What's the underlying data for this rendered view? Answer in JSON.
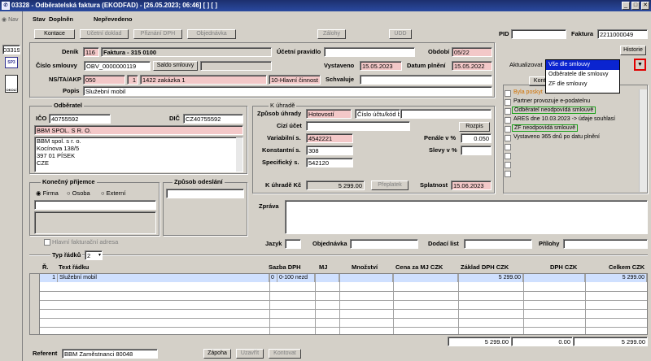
{
  "window": {
    "title": "03328 - Odběratelská faktura (EKODFAD) - [26.05.2023; 06:46] [ ] [ ]",
    "controls": [
      "_",
      "□",
      "✕"
    ]
  },
  "left": {
    "nav": "Nav",
    "code": "03319",
    "icon1": "SP3",
    "icon2": "OKOLÍ"
  },
  "status": {
    "stav_label": "Stav",
    "stav_value": "Doplněn",
    "stav2": "Nepřevedeno"
  },
  "toolbar": {
    "kontace": "Kontace",
    "ucetni_doklad": "Účetní doklad",
    "priznani_dph": "Přiznání DPH",
    "objednavka": "Objednávka",
    "zalohy": "Zálohy",
    "udd": "ÚDD"
  },
  "pid": {
    "label": "PID",
    "value": ""
  },
  "faktura": {
    "label": "Faktura",
    "value": "2211000049"
  },
  "historie": "Historie",
  "header": {
    "denik_label": "Deník",
    "denik_code": "116",
    "denik_name": "Faktura - 315 0100",
    "ucetni_pravidlo_label": "Účetní pravidlo",
    "ucetni_pravidlo": "",
    "obdobi_label": "Období",
    "obdobi": "05/22",
    "cislo_smlouvy_label": "Číslo smlouvy",
    "cislo_smlouvy": "OBV_0000000119",
    "saldo_btn": "Saldo smlouvy",
    "vystaveno_label": "Vystaveno",
    "vystaveno": "15.05.2023",
    "datum_plneni_label": "Datum plnění",
    "datum_plneni": "15.05.2022",
    "ns_label": "NS/TA/AKP",
    "ns": "050",
    "ta": "1",
    "akp": "1422 zakázka 1",
    "cinnost": "10-Hlavní činnost",
    "schvaluje_label": "Schvaluje",
    "schvaluje": "",
    "popis_label": "Popis",
    "popis": "Služební mobil"
  },
  "aktualizovat": "Aktualizovat",
  "kontrola_btn": "Kontrol",
  "dropdown": {
    "selected": "Vše dle smlouvy",
    "options": [
      "Vše dle smlouvy",
      "Odběratele dle smlouvy",
      "ZF dle smlouvy"
    ]
  },
  "checks": [
    {
      "text": "Byla poskyt",
      "color": "#d07000"
    },
    {
      "text": "Partner provozuje e-podatelnu",
      "color": "#000"
    },
    {
      "text": "Odběratel neodpovídá smlouvě",
      "color": "#000"
    },
    {
      "text": "ARES dne 10.03.2023 -> údaje souhlasí",
      "color": "#000"
    },
    {
      "text": "ZF neodpovídá smlouvě",
      "color": "#000"
    },
    {
      "text": "Vystaveno 365 dnů po datu plnění",
      "color": "#000"
    },
    {
      "text": "",
      "color": "#000"
    },
    {
      "text": "",
      "color": "#000"
    },
    {
      "text": "",
      "color": "#000"
    },
    {
      "text": "",
      "color": "#000"
    }
  ],
  "odberatel": {
    "title": "Odběratel",
    "ico_label": "IČO",
    "ico": "40755592",
    "dic_label": "DIČ",
    "dic": "CZ40755592",
    "name": "BBM SPOL. S R. O.",
    "address": [
      "BBM spol. s r. o.",
      "Kocínova 138/5",
      "397 01 PÍSEK",
      "CZE"
    ]
  },
  "konecny": {
    "title": "Konečný příjemce",
    "opts": [
      "Firma",
      "Osoba",
      "Externí"
    ],
    "hlavni": "Hlavní fakturační adresa"
  },
  "zpusob_odeslani": {
    "title": "Způsob odeslání"
  },
  "k_uhrade": {
    "title": "K úhradě",
    "zpusob_label": "Způsob úhrady",
    "zpusob": "Hotovostí",
    "cislo_uctu": "Číslo účtu/kód b",
    "cizi_label": "Cizí účet",
    "rozpis": "Rozpis",
    "vs_label": "Variabilní s.",
    "vs": "4542221",
    "ks_label": "Konstantní s.",
    "ks": "308",
    "ss_label": "Specifický s.",
    "ss": "542120",
    "penale_label": "Penále v %",
    "penale": "0.050",
    "slevy_label": "Slevy v %",
    "slevy": "",
    "kc_label": "K úhradě Kč",
    "kc": "5 299.00",
    "preplatek": "Přeplatek",
    "splatnost_label": "Splatnost",
    "splatnost": "15.06.2023"
  },
  "zprava_label": "Zpráva",
  "bottom": {
    "jazyk": "Jazyk",
    "objednavka": "Objednávka",
    "dodaci_list": "Dodací list",
    "prilohy": "Přílohy"
  },
  "typ_radku": {
    "label": "Typ řádků",
    "value": "2"
  },
  "table": {
    "headers": [
      "Ř.",
      "Text řádku",
      "Sazba DPH",
      "MJ",
      "Množství",
      "Cena za MJ CZK",
      "Základ DPH CZK",
      "DPH CZK",
      "Celkem CZK"
    ],
    "rows": [
      {
        "n": "1",
        "text": "Služební mobil",
        "sazba": "0",
        "sazba2": "0-100 nezd",
        "mj": "",
        "mnozstvi": "",
        "cena": "",
        "zaklad": "5 299.00",
        "dph": "",
        "celkem": "5 299.00"
      }
    ],
    "totals": {
      "zaklad": "5 299.00",
      "dph": "0.00",
      "celkem": "5 299.00"
    }
  },
  "referent": {
    "label": "Referent",
    "value": "BBM Zaměstnanci 80048",
    "zapoha": "Zápoha",
    "uzavrit": "Uzavřít",
    "kontovat": "Kontovat"
  }
}
